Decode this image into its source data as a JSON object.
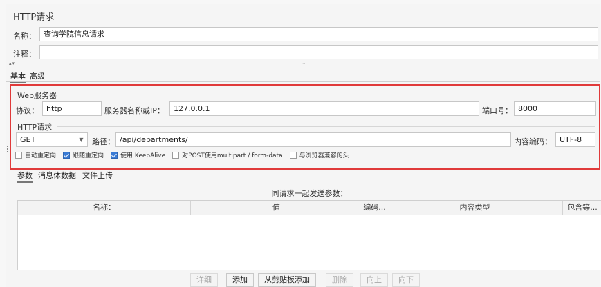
{
  "panel": {
    "title": "HTTP请求"
  },
  "name_label": "名称：",
  "name_value": "查询学院信息请求",
  "comment_label": "注释：",
  "comment_value": "",
  "tabs": {
    "basic": "基本",
    "advanced": "高级"
  },
  "web_server": {
    "group_title": "Web服务器",
    "protocol_label": "协议：",
    "protocol_value": "http",
    "server_label": "服务器名称或IP：",
    "server_value": "127.0.0.1",
    "port_label": "端口号：",
    "port_value": "8000"
  },
  "http_request": {
    "group_title": "HTTP请求",
    "method_value": "GET",
    "path_label": "路径：",
    "path_value": "/api/departments/",
    "encoding_label": "内容编码：",
    "encoding_value": "UTF-8"
  },
  "options": [
    {
      "label": "自动重定向",
      "checked": false
    },
    {
      "label": "跟随重定向",
      "checked": true
    },
    {
      "label": "使用 KeepAlive",
      "checked": true
    },
    {
      "label": "对POST使用multipart / form-data",
      "checked": false
    },
    {
      "label": "与浏览器兼容的头",
      "checked": false
    }
  ],
  "sub_tabs": {
    "params": "参数",
    "body": "消息体数据",
    "upload": "文件上传"
  },
  "params_caption": "同请求一起发送参数：",
  "table_headers": {
    "name": "名称：",
    "value": "值",
    "encode": "编码...",
    "content_type": "内容类型",
    "include_equals": "包含等..."
  },
  "buttons": {
    "detail": "详细",
    "add": "添加",
    "add_clipboard": "从剪贴板添加",
    "delete": "删除",
    "up": "向上",
    "down": "向下"
  },
  "colors": {
    "highlight_border": "#e03a3a",
    "checkbox_on": "#3a7bd5"
  }
}
